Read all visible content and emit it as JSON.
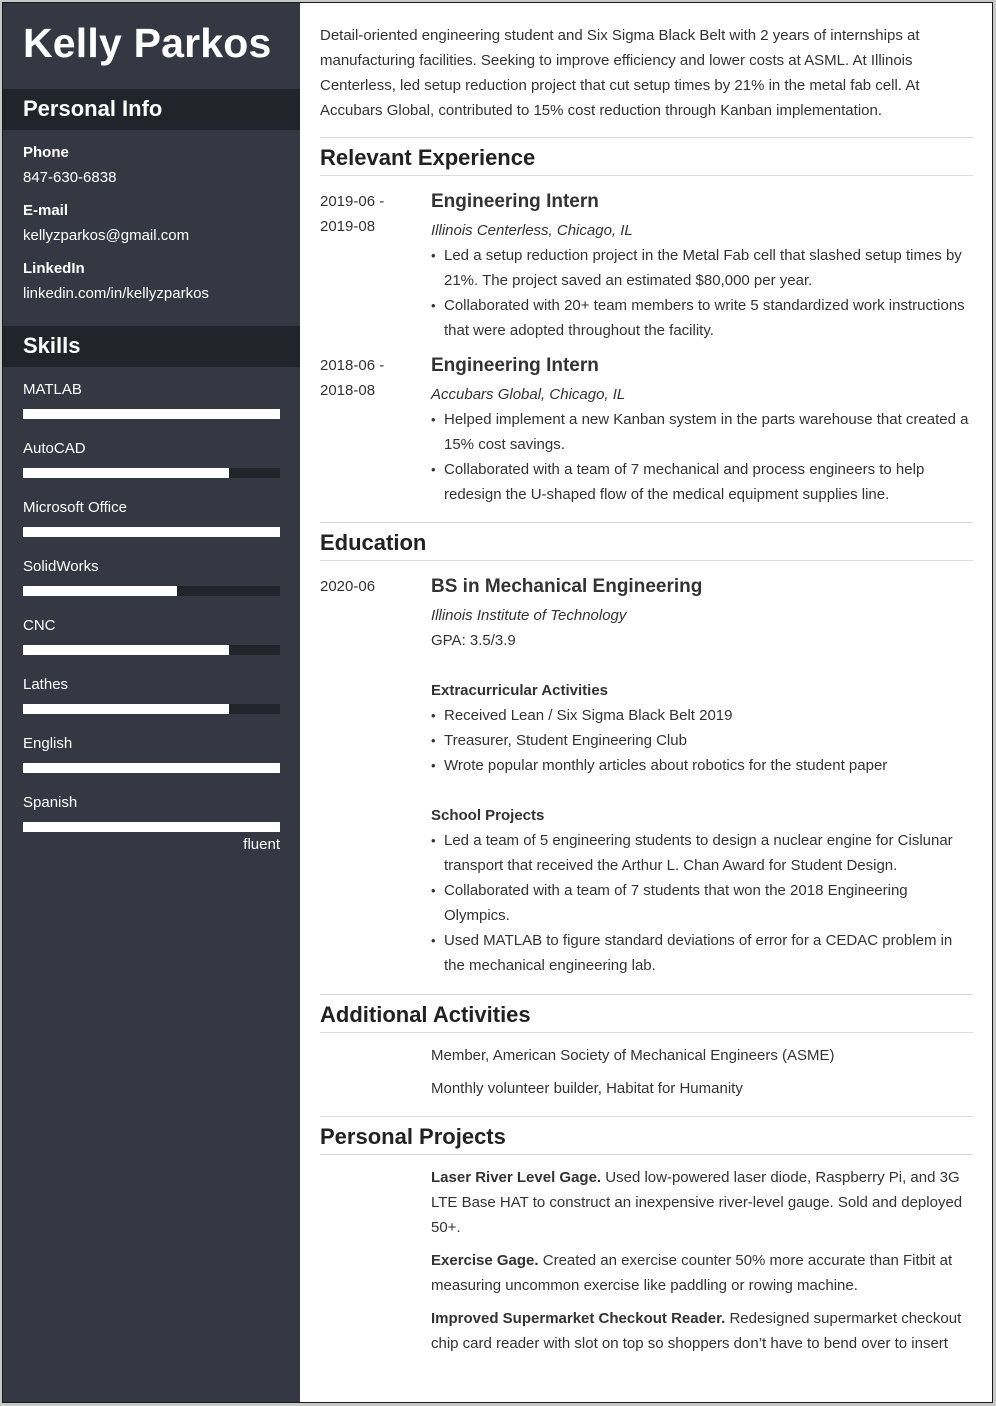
{
  "name": "Kelly Parkos",
  "personal_info": {
    "title": "Personal Info",
    "items": [
      {
        "label": "Phone",
        "value": "847-630-6838"
      },
      {
        "label": "E-mail",
        "value": "kellyzparkos@gmail.com"
      },
      {
        "label": "LinkedIn",
        "value": "linkedin.com/in/kellyzparkos"
      }
    ]
  },
  "skills": {
    "title": "Skills",
    "items": [
      {
        "name": "MATLAB",
        "level_percent": 100
      },
      {
        "name": "AutoCAD",
        "level_percent": 80
      },
      {
        "name": "Microsoft Office",
        "level_percent": 100
      },
      {
        "name": "SolidWorks",
        "level_percent": 60
      },
      {
        "name": "CNC",
        "level_percent": 80
      },
      {
        "name": "Lathes",
        "level_percent": 80
      },
      {
        "name": "English",
        "level_percent": 100
      },
      {
        "name": "Spanish",
        "level_percent": 100,
        "note": "fluent"
      }
    ]
  },
  "summary": "Detail-oriented engineering student and Six Sigma Black Belt with 2 years of internships at manufacturing facilities. Seeking to improve efficiency and lower costs at ASML. At Illinois Centerless, led setup reduction project that cut setup times by 21% in the metal fab cell. At Accubars Global, contributed to 15% cost reduction through Kanban implementation.",
  "experience": {
    "title": "Relevant Experience",
    "entries": [
      {
        "date_start": "2019-06 -",
        "date_end": "2019-08",
        "role": "Engineering Intern",
        "org": "Illinois Centerless, Chicago, IL",
        "bullets": [
          "Led a setup reduction project in the Metal Fab cell that slashed setup times by 21%. The project saved an estimated $80,000 per year.",
          "Collaborated with 20+ team members to write 5 standardized work instructions that were adopted throughout the facility."
        ]
      },
      {
        "date_start": "2018-06 -",
        "date_end": "2018-08",
        "role": "Engineering Intern",
        "org": "Accubars Global, Chicago, IL",
        "bullets": [
          "Helped implement a new Kanban system in the parts warehouse that created a 15% cost savings.",
          "Collaborated with a team of 7 mechanical and process engineers to help redesign the U-shaped flow of the medical equipment supplies line."
        ]
      }
    ]
  },
  "education": {
    "title": "Education",
    "date": "2020-06",
    "degree": "BS in Mechanical Engineering",
    "school": "Illinois Institute of Technology",
    "gpa": "GPA: 3.5/3.9",
    "extracurricular_title": "Extracurricular Activities",
    "extracurricular": [
      "Received Lean / Six Sigma Black Belt 2019",
      "Treasurer, Student Engineering Club",
      "Wrote popular monthly articles about robotics for the student paper"
    ],
    "projects_title": "School Projects",
    "projects": [
      "Led a team of 5 engineering students to design a nuclear engine for Cislunar transport that received the Arthur L. Chan Award for Student Design.",
      "Collaborated with a team of 7 students that won the 2018 Engineering Olympics.",
      "Used MATLAB to figure standard deviations of error for a CEDAC problem in the mechanical engineering lab."
    ]
  },
  "additional": {
    "title": "Additional Activities",
    "items": [
      "Member, American Society of Mechanical Engineers (ASME)",
      "Monthly volunteer builder, Habitat for Humanity"
    ]
  },
  "personal_projects": {
    "title": "Personal Projects",
    "items": [
      {
        "name": "Laser River Level Gage.",
        "text": "Used low-powered laser diode, Raspberry Pi, and 3G LTE Base HAT to construct an inexpensive river-level gauge. Sold and deployed 50+."
      },
      {
        "name": "Exercise Gage.",
        "text": "Created an exercise counter 50% more accurate than Fitbit at measuring uncommon exercise like paddling or rowing machine."
      },
      {
        "name": "Improved Supermarket Checkout Reader.",
        "text": "Redesigned supermarket checkout chip card reader with slot on top so shoppers don’t have to bend over to insert"
      }
    ]
  },
  "colors": {
    "sidebar_bg": "#353842",
    "sidebar_header_bg": "#22242c",
    "bar_fill": "#ffffff",
    "body_text": "#333333"
  }
}
